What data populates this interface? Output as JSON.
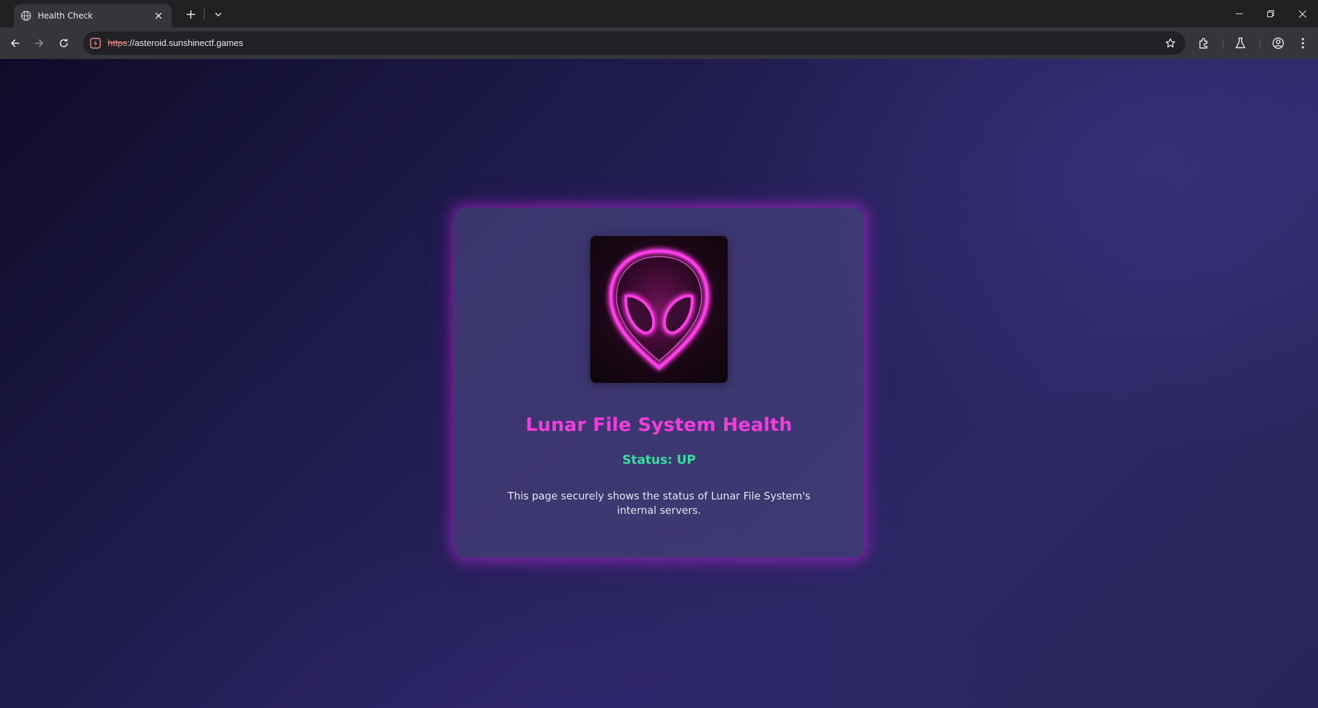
{
  "browser": {
    "tab": {
      "title": "Health Check",
      "favicon": "globe-icon",
      "close_icon": "close-icon"
    },
    "new_tab_icon": "plus-icon",
    "tab_search_icon": "chevron-down-icon",
    "window_controls": [
      "minimize-icon",
      "restore-icon",
      "close-icon"
    ],
    "nav": [
      "back-arrow-icon",
      "forward-arrow-icon",
      "reload-icon"
    ],
    "address": {
      "scheme": "https",
      "rest": "://asteroid.sunshinectf.games",
      "security_icon": "not-secure-icon"
    },
    "toolbar_icons": [
      "bookmark-star-icon",
      "extensions-icon",
      "labs-flask-icon",
      "profile-icon",
      "menu-kebab-icon"
    ]
  },
  "page": {
    "logo": {
      "icon": "neon-alien-head-icon",
      "color": "#ff3ee6"
    },
    "title": "Lunar File System Health",
    "status": "Status: UP",
    "description": "This page securely shows the status of Lunar File System's internal servers."
  },
  "colors": {
    "title": "#f23ddc",
    "status": "#33e0a1",
    "card_glow": "#be28dc",
    "page_bg_dark": "#0f0c29",
    "page_bg_light": "#2c2764"
  }
}
